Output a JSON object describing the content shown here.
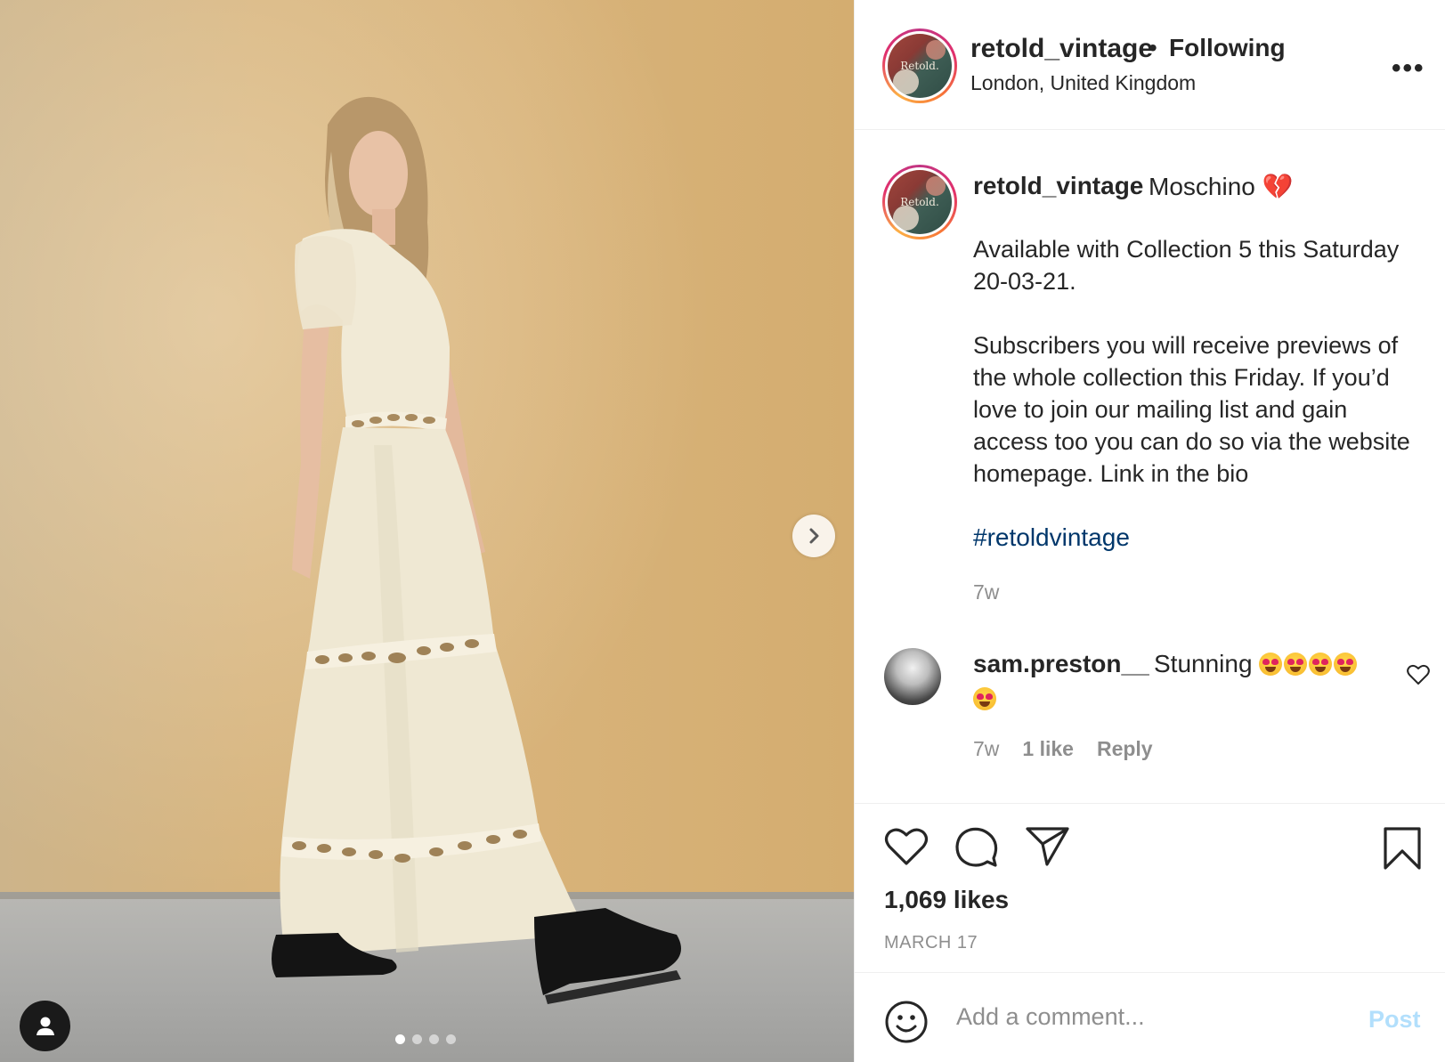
{
  "header": {
    "username": "retold_vintage",
    "separator": "•",
    "follow_status": "Following",
    "location": "London, United Kingdom",
    "avatar_text": "Retold.",
    "more_label": "•••"
  },
  "caption": {
    "username": "retold_vintage",
    "title": "Moschino 💔",
    "paragraph_1": "Available with Collection 5 this Saturday 20-03-21.",
    "paragraph_2": "Subscribers you will receive previews of the whole collection this Friday. If you’d love to join our mailing list and gain access too you can do so via the website homepage. Link in the bio",
    "hashtag": "#retoldvintage",
    "time": "7w",
    "avatar_text": "Retold."
  },
  "comment": {
    "username": "sam.preston__",
    "text": "Stunning",
    "time": "7w",
    "likes": "1 like",
    "reply_label": "Reply"
  },
  "actions": {
    "likes_count": "1,069 likes",
    "date": "MARCH 17"
  },
  "add_comment": {
    "placeholder": "Add a comment...",
    "post_label": "Post"
  },
  "carousel": {
    "total": 4,
    "active_index": 0
  },
  "icons": [
    "like-icon",
    "comment-icon",
    "share-icon",
    "save-icon",
    "smiley-icon",
    "more-icon",
    "next-arrow-icon",
    "tag-user-icon",
    "heart-outline-icon"
  ]
}
